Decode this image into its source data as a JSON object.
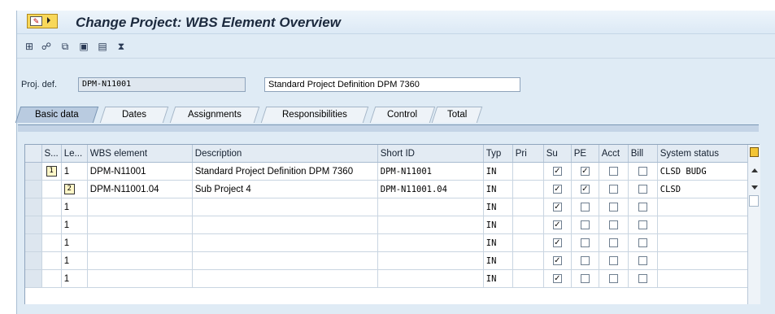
{
  "window": {
    "title": "Change Project: WBS Element Overview"
  },
  "toolbar": {
    "icons": [
      "new-element-icon",
      "hierarchy-icon",
      "copy-icon",
      "expand-icon",
      "collapse-icon",
      "filter-icon"
    ]
  },
  "header": {
    "proj_def_label": "Proj. def.",
    "proj_def_value": "DPM-N11001",
    "proj_desc_value": "Standard Project Definition DPM 7360"
  },
  "tabs": [
    {
      "label": "Basic data",
      "active": true
    },
    {
      "label": "Dates"
    },
    {
      "label": "Assignments"
    },
    {
      "label": "Responsibilities"
    },
    {
      "label": "Control"
    },
    {
      "label": "Total"
    }
  ],
  "grid": {
    "columns": [
      "S...",
      "Le...",
      "WBS element",
      "Description",
      "Short ID",
      "Typ",
      "Pri",
      "Su",
      "PE",
      "Acct",
      "Bill",
      "System status"
    ],
    "rows": [
      {
        "level_icon": "1",
        "level": "1",
        "wbs": "DPM-N11001",
        "desc": "Standard Project Definition DPM 7360",
        "short_id": "DPM-N11001",
        "typ": "IN",
        "pri": "",
        "su": true,
        "pe": true,
        "acct": false,
        "bill": false,
        "status": "CLSD BUDG"
      },
      {
        "level_icon": "2",
        "level": "",
        "wbs": "DPM-N11001.04",
        "desc": "Sub Project 4",
        "short_id": "DPM-N11001.04",
        "typ": "IN",
        "pri": "",
        "su": true,
        "pe": true,
        "acct": false,
        "bill": false,
        "status": "CLSD"
      },
      {
        "level_icon": "",
        "level": "1",
        "wbs": "",
        "desc": "",
        "short_id": "",
        "typ": "IN",
        "pri": "",
        "su": true,
        "pe": false,
        "acct": false,
        "bill": false,
        "status": ""
      },
      {
        "level_icon": "",
        "level": "1",
        "wbs": "",
        "desc": "",
        "short_id": "",
        "typ": "IN",
        "pri": "",
        "su": true,
        "pe": false,
        "acct": false,
        "bill": false,
        "status": ""
      },
      {
        "level_icon": "",
        "level": "1",
        "wbs": "",
        "desc": "",
        "short_id": "",
        "typ": "IN",
        "pri": "",
        "su": true,
        "pe": false,
        "acct": false,
        "bill": false,
        "status": ""
      },
      {
        "level_icon": "",
        "level": "1",
        "wbs": "",
        "desc": "",
        "short_id": "",
        "typ": "IN",
        "pri": "",
        "su": true,
        "pe": false,
        "acct": false,
        "bill": false,
        "status": ""
      },
      {
        "level_icon": "",
        "level": "1",
        "wbs": "",
        "desc": "",
        "short_id": "",
        "typ": "IN",
        "pri": "",
        "su": true,
        "pe": false,
        "acct": false,
        "bill": false,
        "status": ""
      }
    ]
  }
}
